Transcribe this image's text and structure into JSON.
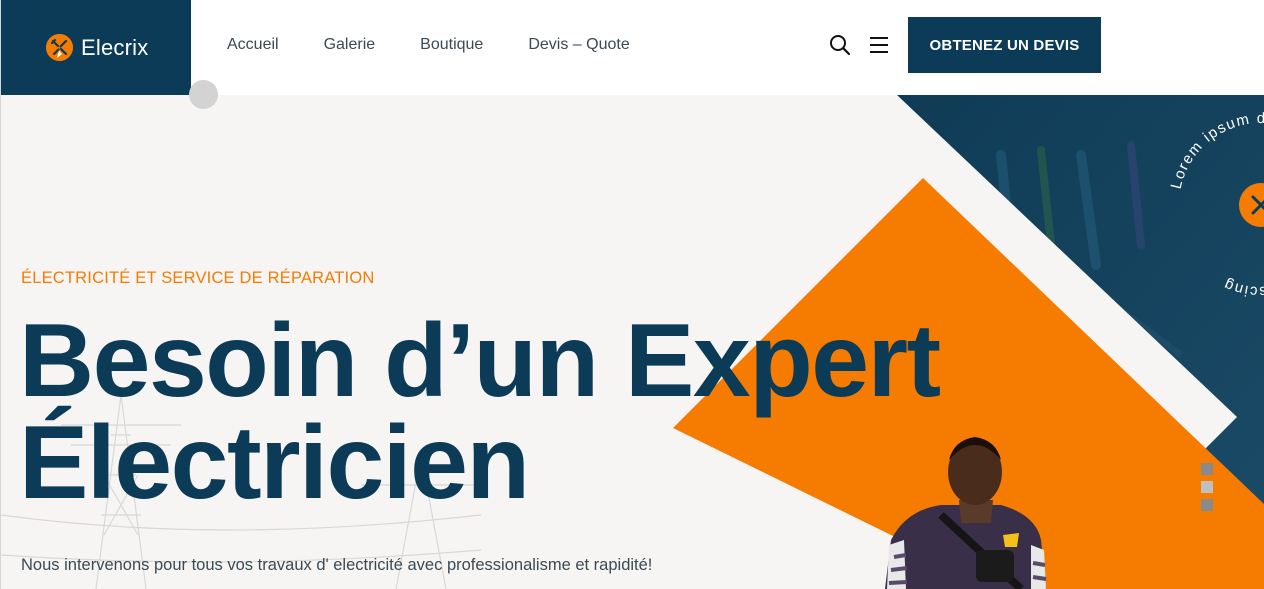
{
  "brand": {
    "name": "Elecrix",
    "logo_icon": "electric-tools-icon",
    "primary_color": "#0c3b57",
    "accent_color": "#f57c00"
  },
  "nav": {
    "items": [
      {
        "label": "Accueil"
      },
      {
        "label": "Galerie"
      },
      {
        "label": "Boutique"
      },
      {
        "label": "Devis – Quote"
      }
    ]
  },
  "header": {
    "search_icon": "search-icon",
    "menu_icon": "hamburger-menu-icon",
    "cta_label": "OBTENEZ UN DEVIS"
  },
  "hero": {
    "subtitle": "ÉLECTRICITÉ ET SERVICE DE RÉPARATION",
    "title_line1": "Besoin d’un Expert",
    "title_line2": "Électricien",
    "lead": "Nous intervenons pour tous vos travaux d' electricité avec professionalisme et rapidité!",
    "badge_text": "Lorem ipsum dolor sit amet consectetur adipiscing",
    "slides_count": 3,
    "active_slide": 1
  }
}
